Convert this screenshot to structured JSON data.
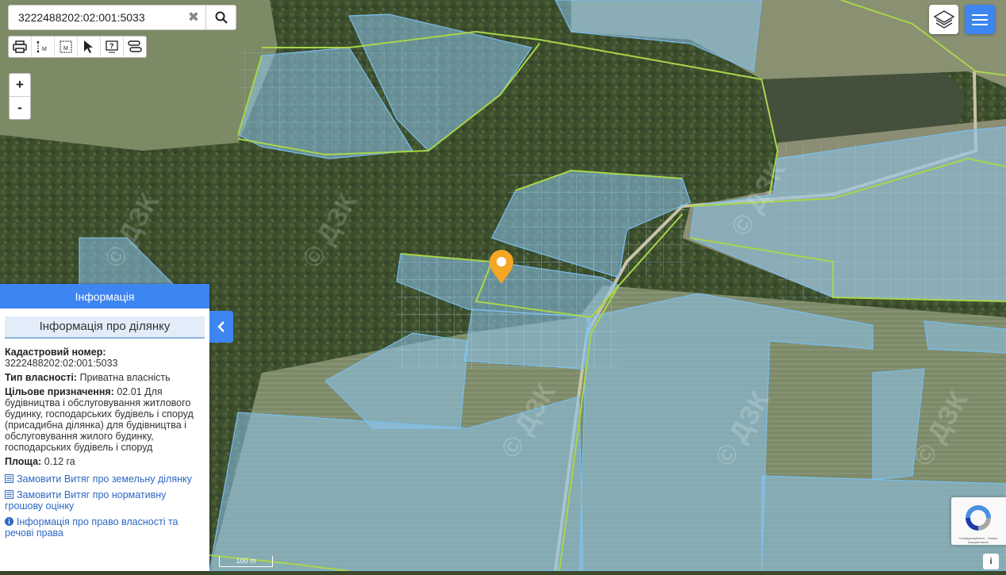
{
  "search": {
    "value": "3222488202:02:001:5033",
    "clear_icon": "close-icon",
    "search_icon": "search-icon"
  },
  "toolbar": {
    "tools": [
      "printer-icon",
      "measure-line-icon",
      "measure-area-icon",
      "pointer-icon",
      "help-icon",
      "route-icon"
    ]
  },
  "zoom": {
    "in_label": "+",
    "out_label": "-"
  },
  "panel": {
    "header": "Інформація",
    "subheader": "Інформація про ділянку",
    "cadastral_label": "Кадастровий номер:",
    "cadastral_value": "3222488202:02:001:5033",
    "ownership_label": "Тип власності:",
    "ownership_value": "Приватна власність",
    "purpose_label": "Цільове призначення:",
    "purpose_value": "02.01 Для будівництва і обслуговування житлового будинку, господарських будівель і споруд (присадибна ділянка) для будівництва і обслуговування жилого будинку, господарських будівель і споруд",
    "area_label": "Площа:",
    "area_value": "0.12 га",
    "link1": "Замовити Витяг про земельну ділянку",
    "link2": "Замовити Витяг про нормативну грошову оцінку",
    "link3": "Інформація про право власності та речові права"
  },
  "map": {
    "scale_label": "100 m",
    "watermark": "© ДЗК"
  },
  "recaptcha": {
    "text": "Конфіденційність - Умови використання"
  },
  "colors": {
    "accent": "#3d85f0",
    "parcel_fill": "#8cc4ec",
    "parcel_stroke": "#78b9e8",
    "boundary": "#a8d64a",
    "marker": "#f5a623"
  }
}
